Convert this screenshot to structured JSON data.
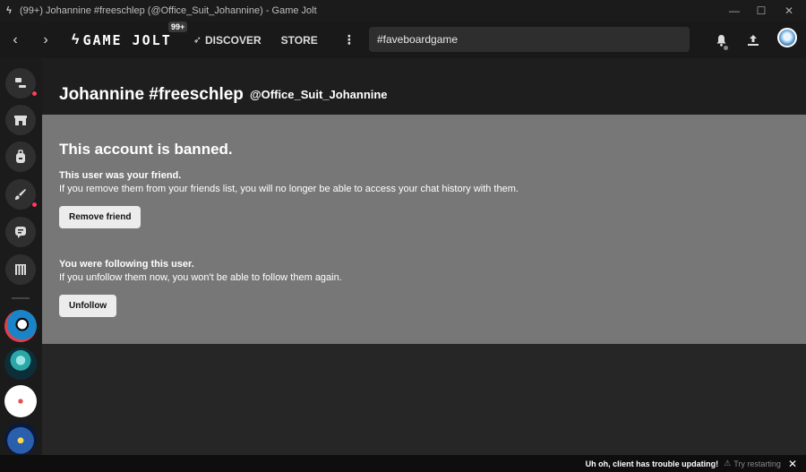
{
  "window": {
    "title": "(99+) Johannine #freeschlep (@Office_Suit_Johannine) - Game Jolt",
    "minimize": "—",
    "maximize": "☐",
    "close": "✕"
  },
  "nav": {
    "back": "‹",
    "forward": "›",
    "logo_text": "GAME JOLT",
    "badge": "99+",
    "discover": "DISCOVER",
    "store": "STORE",
    "more": "⋮",
    "search_value": "#faveboardgame"
  },
  "profile": {
    "display_name": "Johannine #freeschlep",
    "username": "@Office_Suit_Johannine"
  },
  "banned": {
    "heading": "This account is banned.",
    "friend_title": "This user was your friend.",
    "friend_desc": "If you remove them from your friends list, you will no longer be able to access your chat history with them.",
    "remove_friend": "Remove friend",
    "follow_title": "You were following this user.",
    "follow_desc": "If you unfollow them now, you won't be able to follow them again.",
    "unfollow": "Unfollow"
  },
  "status": {
    "message": "Uh oh, client has trouble updating!",
    "retry": "Try restarting",
    "close": "✕"
  },
  "colors": {
    "banned_panel": "#777777",
    "notification_dot": "#ff3c5a",
    "background": "#262626"
  }
}
